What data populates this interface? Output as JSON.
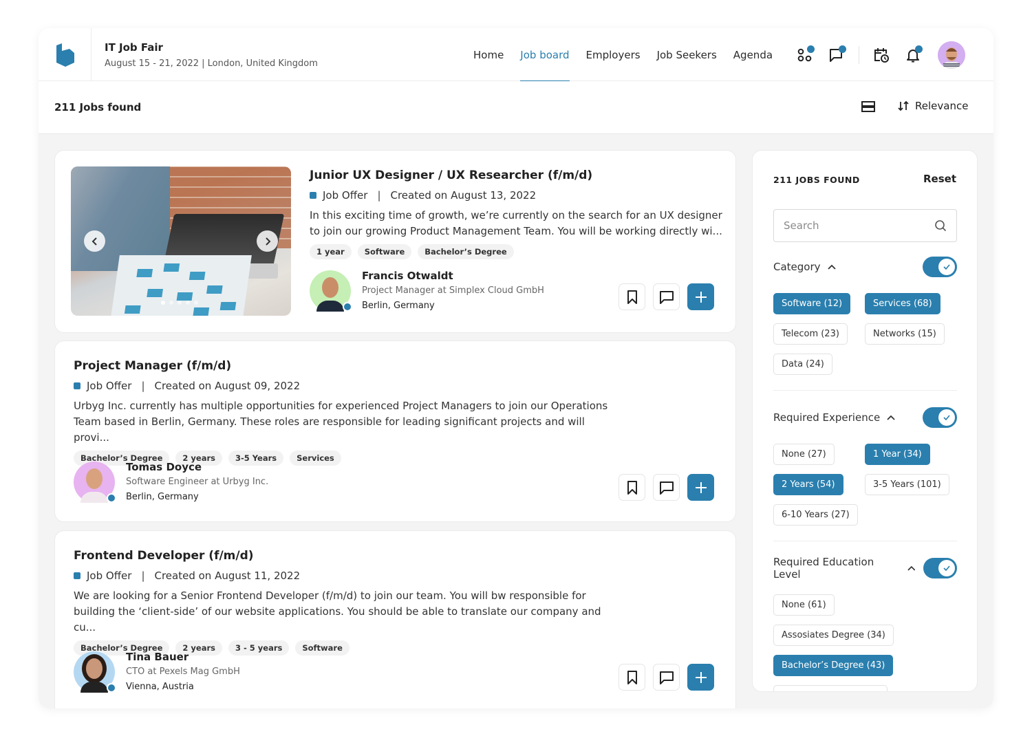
{
  "event": {
    "title": "IT Job Fair",
    "subtitle": "August 15 - 21, 2022 | London, United Kingdom"
  },
  "nav": {
    "items": [
      {
        "label": "Home",
        "active": false
      },
      {
        "label": "Job board",
        "active": true
      },
      {
        "label": "Employers",
        "active": false
      },
      {
        "label": "Job Seekers",
        "active": false
      },
      {
        "label": "Agenda",
        "active": false
      }
    ],
    "icons": [
      "apps-icon",
      "chat-icon",
      "calendar-clock-icon",
      "bell-icon"
    ]
  },
  "subheader": {
    "jobs_found": "211 Jobs found",
    "sort_label": "Relevance"
  },
  "jobs": [
    {
      "title": "Junior UX Designer / UX Researcher (f/m/d)",
      "type": "Job Offer",
      "created": "Created on August 13, 2022",
      "description": "In this exciting time of growth, we’re currently on the search for an UX designer to join our growing Product Management Team. You will be working directly wi...",
      "tags": [
        "1 year",
        "Software",
        "Bachelor’s Degree"
      ],
      "contact": {
        "name": "Francis Otwaldt",
        "role": "Project Manager at Simplex Cloud GmbH",
        "location": "Berlin, Germany"
      },
      "carousel": {
        "slides": 5,
        "active_slide": 1
      }
    },
    {
      "title": "Project Manager (f/m/d)",
      "type": "Job Offer",
      "created": "Created on August 09, 2022",
      "description": "Urbyg Inc. currently has multiple opportunities for experienced Project Managers to join our Operations Team based in Berlin, Germany. These roles are responsible for leading significant projects and will provi...",
      "tags": [
        "Bachelor’s Degree",
        "2 years",
        "3-5 Years",
        "Services"
      ],
      "contact": {
        "name": "Tomas Doyce",
        "role": "Software Engineer at Urbyg Inc.",
        "location": "Berlin, Germany"
      }
    },
    {
      "title": "Frontend Developer (f/m/d)",
      "type": "Job Offer",
      "created": "Created on August 11, 2022",
      "description": "We are looking for a Senior Frontend Developer (f/m/d) to join our team. You will bw responsible for building the ‘client-side’ of our website applications. You should be able to translate our company and cu...",
      "tags": [
        "Bachelor’s Degree",
        "2 years",
        "3 - 5 years",
        "Software"
      ],
      "contact": {
        "name": "Tina Bauer",
        "role": "CTO at Pexels Mag GmbH",
        "location": "Vienna, Austria"
      }
    }
  ],
  "separator": "|",
  "filters": {
    "heading": "211 JOBS FOUND",
    "reset_label": "Reset",
    "search_placeholder": "Search",
    "sections": [
      {
        "title": "Category",
        "enabled": true,
        "options": [
          {
            "label": "Software (12)",
            "selected": true
          },
          {
            "label": "Services (68)",
            "selected": true
          },
          {
            "label": "Telecom (23)",
            "selected": false
          },
          {
            "label": "Networks (15)",
            "selected": false
          },
          {
            "label": "Data (24)",
            "selected": false
          }
        ]
      },
      {
        "title": "Required Experience",
        "enabled": true,
        "options": [
          {
            "label": "None (27)",
            "selected": false
          },
          {
            "label": "1 Year (34)",
            "selected": true
          },
          {
            "label": "2 Years (54)",
            "selected": true
          },
          {
            "label": "3-5 Years (101)",
            "selected": false
          },
          {
            "label": "6-10 Years (27)",
            "selected": false
          }
        ]
      },
      {
        "title": "Required Education Level",
        "enabled": true,
        "options": [
          {
            "label": "None (61)",
            "selected": false
          },
          {
            "label": "Assosiates Degree (34)",
            "selected": false
          },
          {
            "label": "Bachelor’s Degree (43)",
            "selected": true
          },
          {
            "label": "",
            "selected": false
          }
        ]
      }
    ]
  },
  "colors": {
    "accent": "#2a7fae"
  }
}
